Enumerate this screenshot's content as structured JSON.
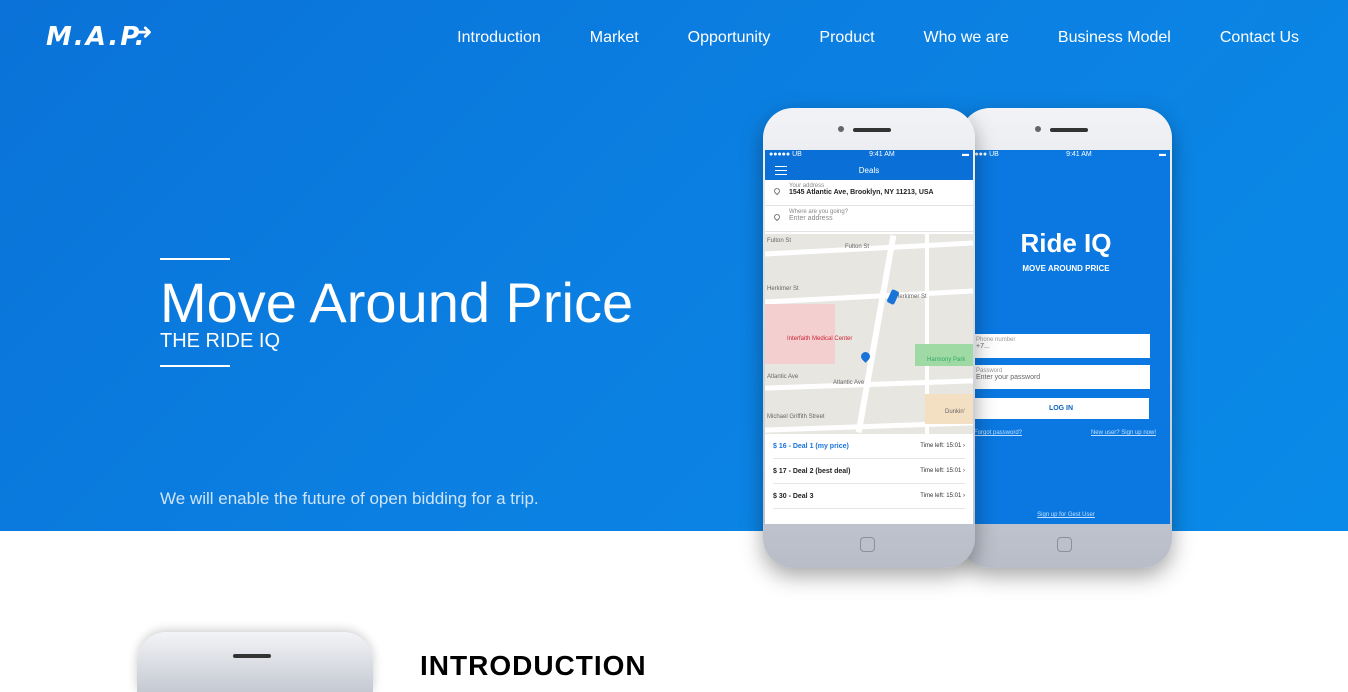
{
  "brand": {
    "logo_text": "M.A.P.",
    "logo_arrow": "➜"
  },
  "nav": {
    "items": [
      "Introduction",
      "Market",
      "Opportunity",
      "Product",
      "Who we are",
      "Business Model",
      "Contact Us"
    ]
  },
  "hero": {
    "title": "Move Around Price",
    "subtitle": "THE RIDE IQ",
    "tagline": "We will enable the future of open bidding for a trip."
  },
  "phone_deals": {
    "status_left": "●●●●● UB",
    "status_time": "9:41 AM",
    "header": "Deals",
    "address_label": "Your address",
    "address_value": "1545 Atlantic Ave, Brooklyn, NY 11213, USA",
    "dest_label": "Where are you going?",
    "dest_placeholder": "Enter address",
    "map_labels": {
      "fulton": "Fulton St",
      "fulton2": "Fulton St",
      "herkimer": "Herkimer St",
      "herkimer2": "Herkimer St",
      "hospital": "Interfaith Medical Center",
      "park": "Harmony Park",
      "atlantic": "Atlantic Ave",
      "atlantic2": "Atlantic Ave",
      "griffith": "Michael Griffith Street",
      "dunkin": "Dunkin'"
    },
    "deals": [
      {
        "price": "$ 16 - Deal 1 (my price)",
        "time": "Time left: 15:01"
      },
      {
        "price": "$ 17 - Deal 2 (best deal)",
        "time": "Time left: 15:01"
      },
      {
        "price": "$ 30 - Deal 3",
        "time": "Time left: 15:01"
      }
    ]
  },
  "phone_login": {
    "status_left": "●●●●● UB",
    "status_time": "9:41 AM",
    "app_name": "Ride IQ",
    "app_tagline": "MOVE AROUND PRICE",
    "phone_label": "Phone number",
    "phone_value": "+7...",
    "password_label": "Password",
    "password_placeholder": "Enter your password",
    "login_button": "LOG IN",
    "forgot_link": "Forgot password?",
    "signup_link": "New user? Sign up now!",
    "guest_link": "Sign up for Gest User"
  },
  "intro": {
    "heading": "INTRODUCTION"
  },
  "colors": {
    "hero_blue": "#0b80e2",
    "white": "#ffffff"
  }
}
